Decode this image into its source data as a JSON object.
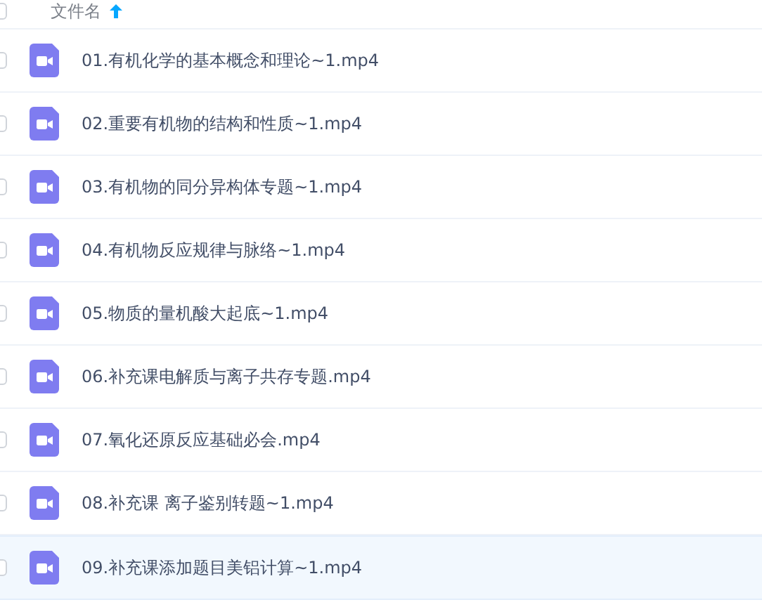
{
  "header": {
    "column_label": "文件名",
    "select_all_checked": false
  },
  "files": [
    {
      "name": "01.有机化学的基本概念和理论~1.mp4",
      "checked": false,
      "highlighted": false
    },
    {
      "name": "02.重要有机物的结构和性质~1.mp4",
      "checked": false,
      "highlighted": false
    },
    {
      "name": "03.有机物的同分异构体专题~1.mp4",
      "checked": false,
      "highlighted": false
    },
    {
      "name": "04.有机物反应规律与脉络~1.mp4",
      "checked": false,
      "highlighted": false
    },
    {
      "name": "05.物质的量机酸大起底~1.mp4",
      "checked": false,
      "highlighted": false
    },
    {
      "name": "06.补充课电解质与离子共存专题.mp4",
      "checked": false,
      "highlighted": false
    },
    {
      "name": "07.氧化还原反应基础必会.mp4",
      "checked": false,
      "highlighted": false
    },
    {
      "name": "08.补充课 离子鉴别转题~1.mp4",
      "checked": false,
      "highlighted": false
    },
    {
      "name": "09.补充课添加题目美铝计算~1.mp4",
      "checked": false,
      "highlighted": true
    }
  ]
}
